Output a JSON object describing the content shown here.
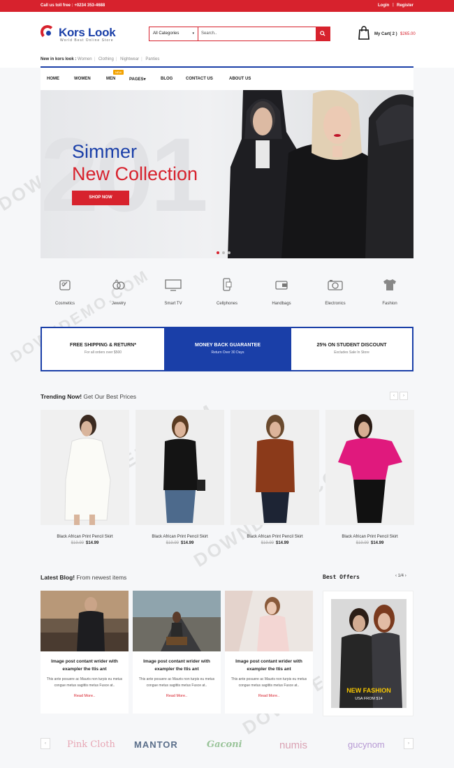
{
  "topbar": {
    "phone": "Call us toll free : +0234 353-4688",
    "login": "Login",
    "separator": "|",
    "register": "Register"
  },
  "header": {
    "logo_name": "Kors Look",
    "logo_tagline": "World Best Online Store",
    "search": {
      "category": "All Categories",
      "placeholder": "Search..",
      "button_icon": "search-icon"
    },
    "cart": {
      "label": "My Cart( 2 )",
      "amount": "$265.00",
      "icon": "bag-icon"
    }
  },
  "new_in": {
    "label": "New in kors look :",
    "links": [
      "Women",
      "Clothing",
      "Nightwear",
      "Panties"
    ]
  },
  "nav": {
    "items": [
      "HOME",
      "WOMEN",
      "MEN",
      "PAGES",
      "BLOG",
      "CONTACT US",
      "ABOUT US"
    ],
    "badge": "NEW",
    "pages_caret": "▾"
  },
  "hero": {
    "watermark_text": "201",
    "line1": "Simmer",
    "line2": "New Collection",
    "button": "SHOP NOW",
    "slides": 3,
    "active_slide": 1
  },
  "categories": [
    {
      "label": "Cosmetics",
      "icon": "cosmetics-icon"
    },
    {
      "label": "Jewelry",
      "icon": "rings-icon"
    },
    {
      "label": "Smart TV",
      "icon": "tv-icon"
    },
    {
      "label": "Cellphones",
      "icon": "phone-icon"
    },
    {
      "label": "Handbags",
      "icon": "wallet-icon"
    },
    {
      "label": "Electronics",
      "icon": "camera-icon"
    },
    {
      "label": "Fashion",
      "icon": "tshirt-icon"
    }
  ],
  "features": [
    {
      "title": "FREE SHIPPING & RETURN*",
      "sub": "For all orders over $500"
    },
    {
      "title": "MONEY BACK GUARANTEE",
      "sub": "Return Over 30 Days"
    },
    {
      "title": "25% ON STUDENT DISCOUNT",
      "sub": "Excludes Sale In Store"
    }
  ],
  "trending": {
    "title_bold": "Trending Now!",
    "title_rest": " Get Our Best Prices",
    "prev": "‹",
    "next": "›",
    "products": [
      {
        "name": "Black African Print Pencil Skirt",
        "old_price": "$19.99",
        "price": "$14.99"
      },
      {
        "name": "Black African Print Pencil Skirt",
        "old_price": "$19.99",
        "price": "$14.99"
      },
      {
        "name": "Black African Print Pencil Skirt",
        "old_price": "$19.99",
        "price": "$14.99"
      },
      {
        "name": "Black African Print Pencil Skirt",
        "old_price": "$19.99",
        "price": "$14.99"
      }
    ]
  },
  "blog": {
    "title_bold": "Latest Blog!",
    "title_rest": " From newest items",
    "posts": [
      {
        "title": "Image post contant wrider with exampler the ttis ant",
        "text": "This ante posuere ac Mauris non turpis eu metus congue metus sagittis metus Fusce at..",
        "read_more": "Read More.."
      },
      {
        "title": "Image post contant wrider with exampler the ttis ant",
        "text": "This ante posuere ac Mauris non turpis eu metus congue metus sagittis metus Fusce at..",
        "read_more": "Read More.."
      },
      {
        "title": "Image post contant wrider with exampler the ttis ant",
        "text": "This ante posuere ac Mauris non turpis eu metus congue metus sagittis metus Fusce at..",
        "read_more": "Read More.."
      }
    ]
  },
  "best_offers": {
    "title": "Best Offers",
    "pager": "1/4",
    "prev": "‹",
    "next": "›",
    "banner_title": "NEW FASHION",
    "banner_sub": "USA FROM $14"
  },
  "brands": [
    "Pink Cloth",
    "MANTOR",
    "Gaconi",
    "numis",
    "gucynom"
  ],
  "watermark": "DOWNDEMO.COM",
  "colors": {
    "primary_red": "#d7222d",
    "primary_blue": "#1a3fa8"
  }
}
